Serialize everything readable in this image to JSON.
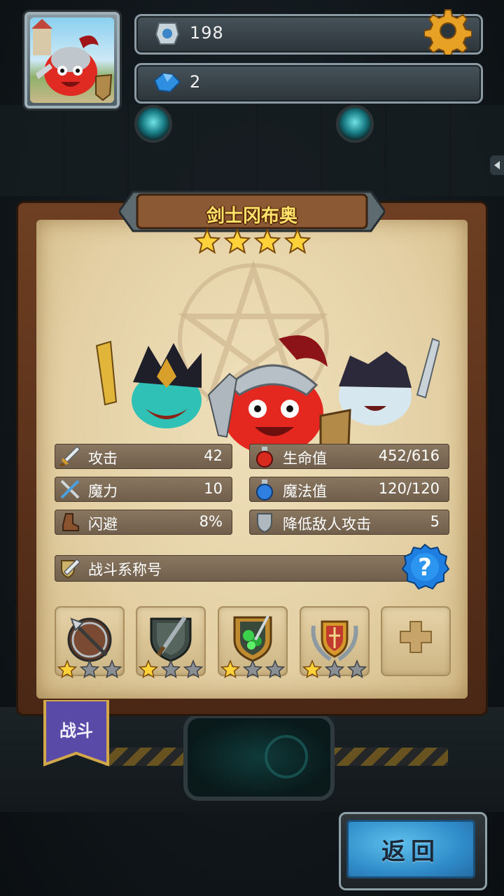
{
  "header": {
    "resource1_value": "198",
    "resource2_value": "2"
  },
  "hero": {
    "name": "剑士冈布奥",
    "stars": 4
  },
  "stats": {
    "attack": {
      "label": "攻击",
      "value": "42"
    },
    "magic_power": {
      "label": "魔力",
      "value": "10"
    },
    "dodge": {
      "label": "闪避",
      "value": "8%"
    },
    "hp": {
      "label": "生命值",
      "value": "452/616"
    },
    "mp": {
      "label": "魔法值",
      "value": "120/120"
    },
    "reduce_enemy_attack": {
      "label": "降低敌人攻击",
      "value": "5"
    }
  },
  "title_row": {
    "label": "战斗系称号"
  },
  "skills": [
    {
      "icon": "spear-shield-icon",
      "stars": 1,
      "max_stars": 3
    },
    {
      "icon": "dagger-shield-icon",
      "stars": 1,
      "max_stars": 3
    },
    {
      "icon": "poison-crest-icon",
      "stars": 1,
      "max_stars": 3
    },
    {
      "icon": "laurel-shield-icon",
      "stars": 1,
      "max_stars": 3
    }
  ],
  "tab": {
    "label": "战斗"
  },
  "return_button": {
    "label": "返回"
  },
  "colors": {
    "gold": "#ffd23a",
    "star_empty": "#8a8f94",
    "help_blue": "#1e88e5",
    "return_blue": "#3aa2dc"
  }
}
